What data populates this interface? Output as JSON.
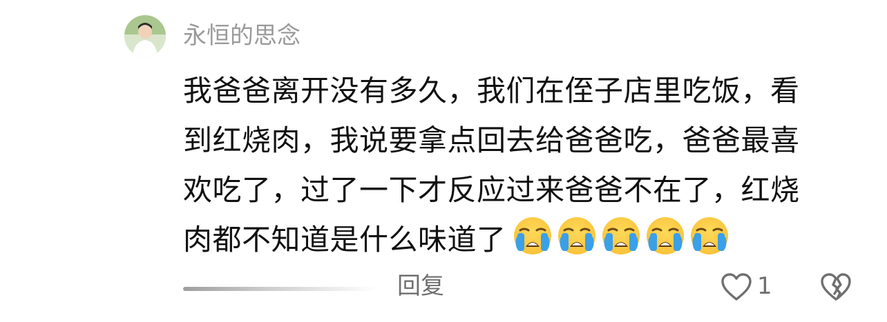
{
  "comment": {
    "username": "永恒的思念",
    "lines": [
      "我爸爸离开没有多久，我们在侄子店里吃饭，看",
      "到红烧肉，我说要拿点回去给爸爸吃，爸爸最喜",
      "欢吃了，过了一下才反应过来爸爸不在了，红烧",
      "肉都不知道是什么味道了"
    ],
    "emojis": [
      "loudly-crying-face-icon",
      "loudly-crying-face-icon",
      "loudly-crying-face-icon",
      "loudly-crying-face-icon",
      "loudly-crying-face-icon"
    ]
  },
  "actions": {
    "reply_label": "回复",
    "like_icon": "heart-outline-icon",
    "like_count": "1",
    "dislike_icon": "broken-heart-icon"
  },
  "colors": {
    "username": "#9a9a9a",
    "text": "#111111",
    "secondary": "#6f6f6f",
    "emoji_face": "#f9c33a",
    "emoji_tears": "#3aa0e8"
  }
}
